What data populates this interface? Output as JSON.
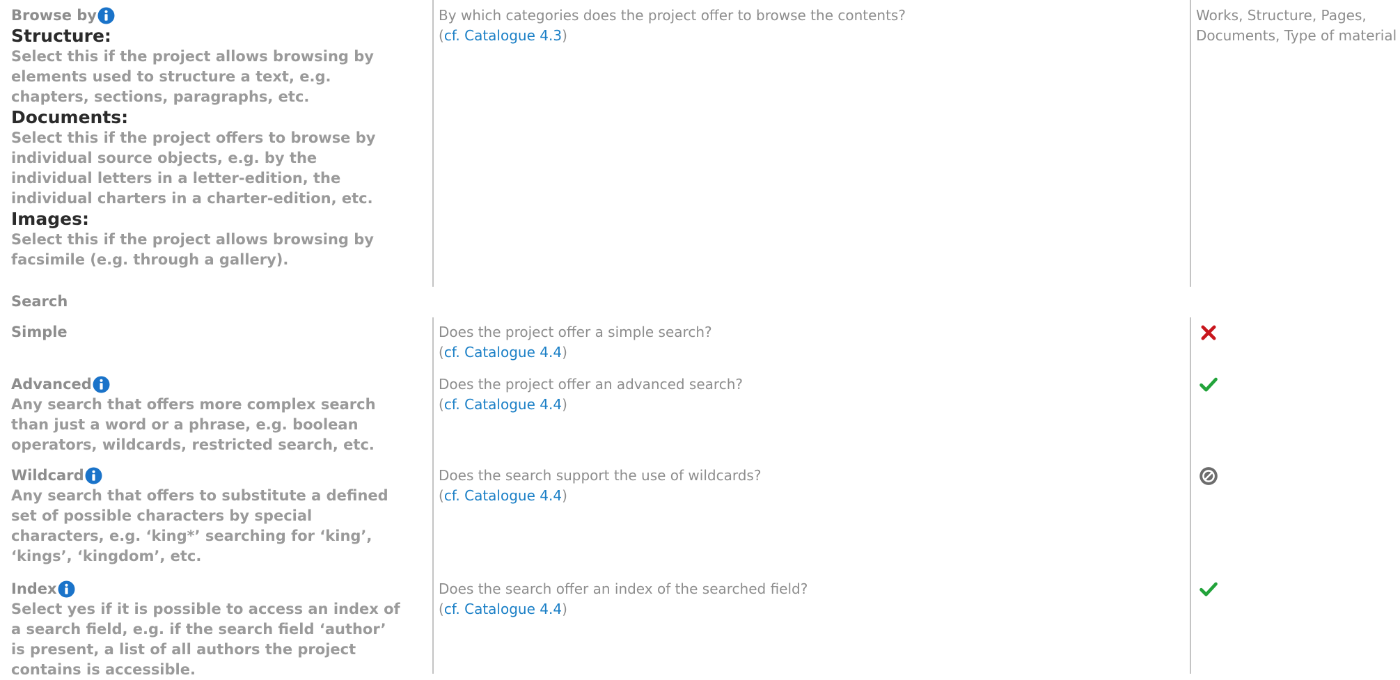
{
  "browse_by": {
    "label": "Browse by",
    "structure_title": "Structure:",
    "structure_desc": "Select this if the project allows browsing by elements used to structure a text, e.g. chapters, sections, paragraphs, etc.",
    "documents_title": "Documents:",
    "documents_desc": "Select this if the project offers to browse by individual source objects, e.g. by the individual letters in a letter-edition, the individual charters in a charter-edition, etc.",
    "images_title": "Images:",
    "images_desc": "Select this if the project allows browsing by facsimile (e.g. through a gallery).",
    "question": "By which categories does the project offer to browse the contents?",
    "ref_open": "(",
    "ref_link": "cf. Catalogue 4.3",
    "ref_close": ")",
    "answer": "Works, Structure, Pages, Documents, Type of material"
  },
  "search_section": {
    "label": "Search"
  },
  "rows": [
    {
      "label": "Simple",
      "desc": "",
      "question": "Does the project offer a simple search?",
      "ref_link": "cf. Catalogue 4.4",
      "status": "cross-icon"
    },
    {
      "label": "Advanced",
      "desc": "Any search that offers more complex search than just a word or a phrase, e.g. boolean operators, wildcards, restricted search, etc.",
      "question": "Does the project offer an advanced search?",
      "ref_link": "cf. Catalogue 4.4",
      "status": "check-icon"
    },
    {
      "label": "Wildcard",
      "desc": "Any search that offers to substitute a defined set of possible characters by special characters, e.g. ‘king*’ searching for ‘king’, ‘kings’, ‘kingdom’, etc.",
      "question": "Does the search support the use of wildcards?",
      "ref_link": "cf. Catalogue 4.4",
      "status": "not-applicable-icon"
    },
    {
      "label": "Index",
      "desc": "Select yes if it is possible to access an index of a search field, e.g. if the search field ‘author’ is present, a list of all authors the project contains is accessible.",
      "question": "Does the search offer an index of the searched field?",
      "ref_link": "cf. Catalogue 4.4",
      "status": "check-icon"
    }
  ],
  "colors": {
    "link": "#1a7fc6",
    "info": "#1a73c9",
    "cross": "#c8161d",
    "check": "#22a33a",
    "na": "#6c6c6c"
  }
}
